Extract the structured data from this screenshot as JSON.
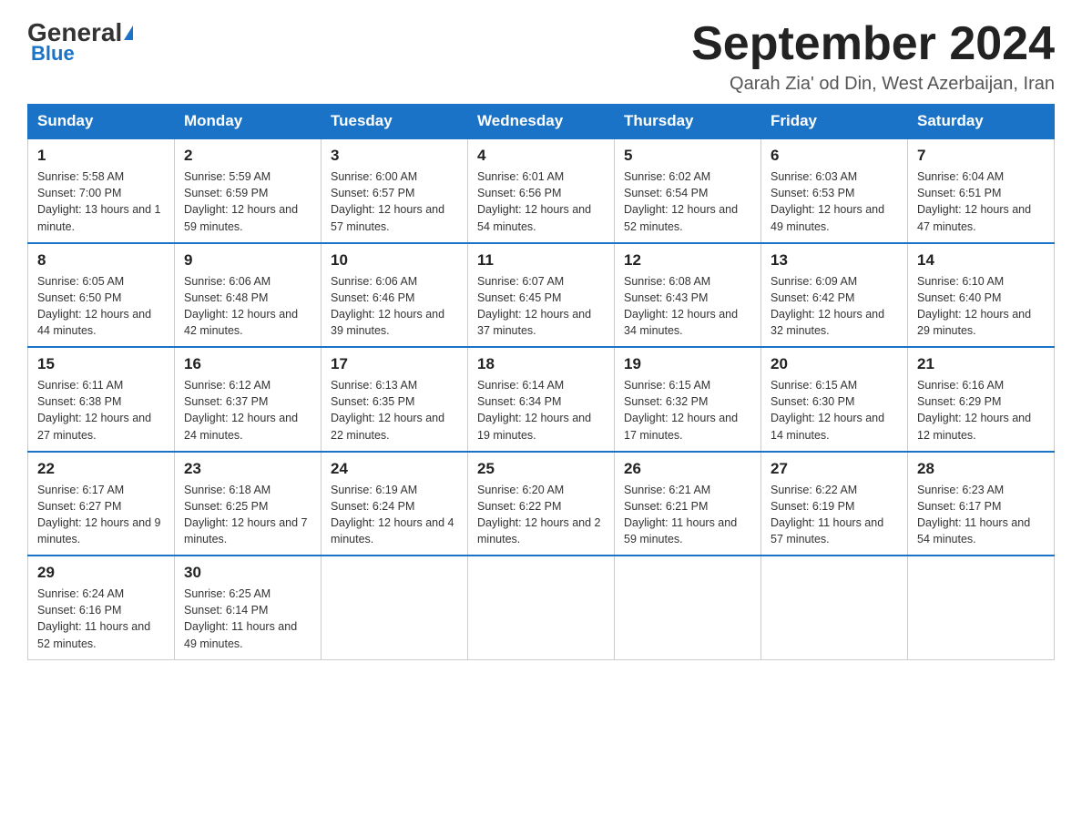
{
  "header": {
    "logo_general": "General",
    "logo_blue": "Blue",
    "month_title": "September 2024",
    "subtitle": "Qarah Zia' od Din, West Azerbaijan, Iran"
  },
  "calendar": {
    "days_of_week": [
      "Sunday",
      "Monday",
      "Tuesday",
      "Wednesday",
      "Thursday",
      "Friday",
      "Saturday"
    ],
    "weeks": [
      [
        {
          "day": "1",
          "sunrise": "5:58 AM",
          "sunset": "7:00 PM",
          "daylight": "13 hours and 1 minute."
        },
        {
          "day": "2",
          "sunrise": "5:59 AM",
          "sunset": "6:59 PM",
          "daylight": "12 hours and 59 minutes."
        },
        {
          "day": "3",
          "sunrise": "6:00 AM",
          "sunset": "6:57 PM",
          "daylight": "12 hours and 57 minutes."
        },
        {
          "day": "4",
          "sunrise": "6:01 AM",
          "sunset": "6:56 PM",
          "daylight": "12 hours and 54 minutes."
        },
        {
          "day": "5",
          "sunrise": "6:02 AM",
          "sunset": "6:54 PM",
          "daylight": "12 hours and 52 minutes."
        },
        {
          "day": "6",
          "sunrise": "6:03 AM",
          "sunset": "6:53 PM",
          "daylight": "12 hours and 49 minutes."
        },
        {
          "day": "7",
          "sunrise": "6:04 AM",
          "sunset": "6:51 PM",
          "daylight": "12 hours and 47 minutes."
        }
      ],
      [
        {
          "day": "8",
          "sunrise": "6:05 AM",
          "sunset": "6:50 PM",
          "daylight": "12 hours and 44 minutes."
        },
        {
          "day": "9",
          "sunrise": "6:06 AM",
          "sunset": "6:48 PM",
          "daylight": "12 hours and 42 minutes."
        },
        {
          "day": "10",
          "sunrise": "6:06 AM",
          "sunset": "6:46 PM",
          "daylight": "12 hours and 39 minutes."
        },
        {
          "day": "11",
          "sunrise": "6:07 AM",
          "sunset": "6:45 PM",
          "daylight": "12 hours and 37 minutes."
        },
        {
          "day": "12",
          "sunrise": "6:08 AM",
          "sunset": "6:43 PM",
          "daylight": "12 hours and 34 minutes."
        },
        {
          "day": "13",
          "sunrise": "6:09 AM",
          "sunset": "6:42 PM",
          "daylight": "12 hours and 32 minutes."
        },
        {
          "day": "14",
          "sunrise": "6:10 AM",
          "sunset": "6:40 PM",
          "daylight": "12 hours and 29 minutes."
        }
      ],
      [
        {
          "day": "15",
          "sunrise": "6:11 AM",
          "sunset": "6:38 PM",
          "daylight": "12 hours and 27 minutes."
        },
        {
          "day": "16",
          "sunrise": "6:12 AM",
          "sunset": "6:37 PM",
          "daylight": "12 hours and 24 minutes."
        },
        {
          "day": "17",
          "sunrise": "6:13 AM",
          "sunset": "6:35 PM",
          "daylight": "12 hours and 22 minutes."
        },
        {
          "day": "18",
          "sunrise": "6:14 AM",
          "sunset": "6:34 PM",
          "daylight": "12 hours and 19 minutes."
        },
        {
          "day": "19",
          "sunrise": "6:15 AM",
          "sunset": "6:32 PM",
          "daylight": "12 hours and 17 minutes."
        },
        {
          "day": "20",
          "sunrise": "6:15 AM",
          "sunset": "6:30 PM",
          "daylight": "12 hours and 14 minutes."
        },
        {
          "day": "21",
          "sunrise": "6:16 AM",
          "sunset": "6:29 PM",
          "daylight": "12 hours and 12 minutes."
        }
      ],
      [
        {
          "day": "22",
          "sunrise": "6:17 AM",
          "sunset": "6:27 PM",
          "daylight": "12 hours and 9 minutes."
        },
        {
          "day": "23",
          "sunrise": "6:18 AM",
          "sunset": "6:25 PM",
          "daylight": "12 hours and 7 minutes."
        },
        {
          "day": "24",
          "sunrise": "6:19 AM",
          "sunset": "6:24 PM",
          "daylight": "12 hours and 4 minutes."
        },
        {
          "day": "25",
          "sunrise": "6:20 AM",
          "sunset": "6:22 PM",
          "daylight": "12 hours and 2 minutes."
        },
        {
          "day": "26",
          "sunrise": "6:21 AM",
          "sunset": "6:21 PM",
          "daylight": "11 hours and 59 minutes."
        },
        {
          "day": "27",
          "sunrise": "6:22 AM",
          "sunset": "6:19 PM",
          "daylight": "11 hours and 57 minutes."
        },
        {
          "day": "28",
          "sunrise": "6:23 AM",
          "sunset": "6:17 PM",
          "daylight": "11 hours and 54 minutes."
        }
      ],
      [
        {
          "day": "29",
          "sunrise": "6:24 AM",
          "sunset": "6:16 PM",
          "daylight": "11 hours and 52 minutes."
        },
        {
          "day": "30",
          "sunrise": "6:25 AM",
          "sunset": "6:14 PM",
          "daylight": "11 hours and 49 minutes."
        },
        null,
        null,
        null,
        null,
        null
      ]
    ]
  }
}
